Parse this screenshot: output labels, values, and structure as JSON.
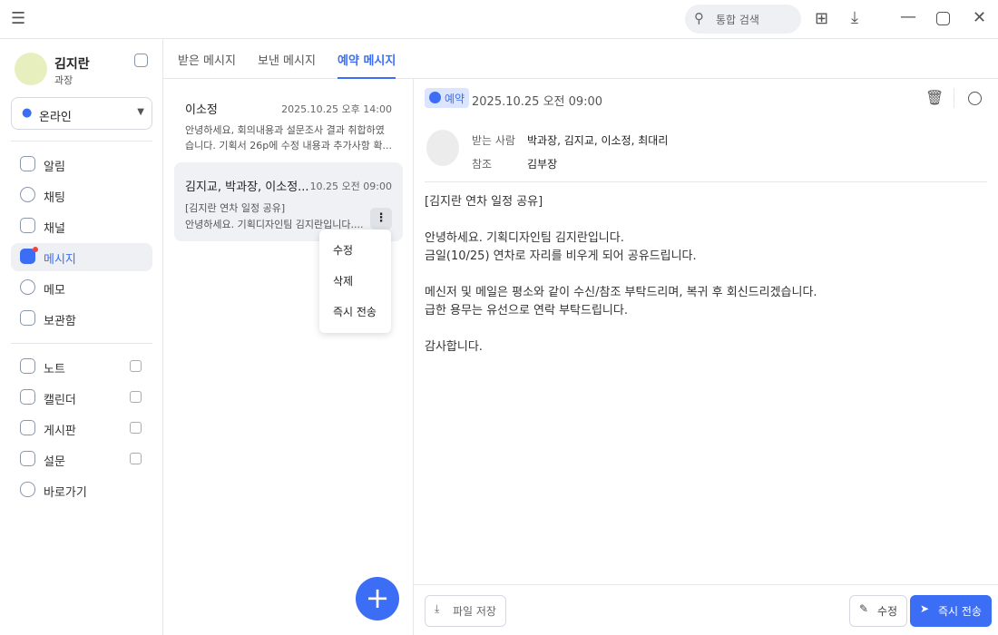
{
  "topbar": {
    "search_placeholder": "통합 검색"
  },
  "user": {
    "name": "김지란",
    "title": "과장",
    "status": "온라인"
  },
  "sidebar": {
    "items": [
      {
        "label": "알림"
      },
      {
        "label": "채팅"
      },
      {
        "label": "채널"
      },
      {
        "label": "메시지"
      },
      {
        "label": "메모"
      },
      {
        "label": "보관함"
      }
    ],
    "links": [
      {
        "label": "노트"
      },
      {
        "label": "캘린더"
      },
      {
        "label": "게시판"
      },
      {
        "label": "설문"
      },
      {
        "label": "바로가기"
      }
    ]
  },
  "tabs": [
    {
      "label": "받은 메시지"
    },
    {
      "label": "보낸 메시지"
    },
    {
      "label": "예약 메시지"
    }
  ],
  "messages": [
    {
      "sender": "이소정",
      "time": "2025.10.25 오후 14:00",
      "preview": "안녕하세요, 회의내용과 설문조사 결과 취합하였습니다. 기획서 26p에 수정 내용과 추가사항 확..."
    },
    {
      "sender": "김지교, 박과장, 이소정...",
      "time": "10.25 오전 09:00",
      "subject": "[김지란 연차 일정 공유]",
      "preview": "안녕하세요. 기획디자인팀 김지란입니다...."
    }
  ],
  "context_menu": [
    "수정",
    "삭제",
    "즉시 전송"
  ],
  "detail": {
    "badge": "예약",
    "datetime": "2025.10.25 오전 09:00",
    "to_label": "받는 사람",
    "to": "박과장, 김지교, 이소정, 최대리",
    "cc_label": "참조",
    "cc": "김부장",
    "body": [
      "[김지란 연차 일정 공유]",
      "",
      "안녕하세요. 기획디자인팀 김지란입니다.",
      "금일(10/25) 연차로 자리를 비우게 되어 공유드립니다.",
      "",
      "메신저 및 메일은 평소와 같이 수신/참조 부탁드리며, 복귀 후 회신드리겠습니다.",
      "급한 용무는 유선으로 연락 부탁드립니다.",
      "",
      "감사합니다."
    ],
    "save_file": "파일 저장",
    "edit": "수정",
    "send_now": "즉시 전송"
  },
  "colors": {
    "accent": "#3b6ef5"
  }
}
